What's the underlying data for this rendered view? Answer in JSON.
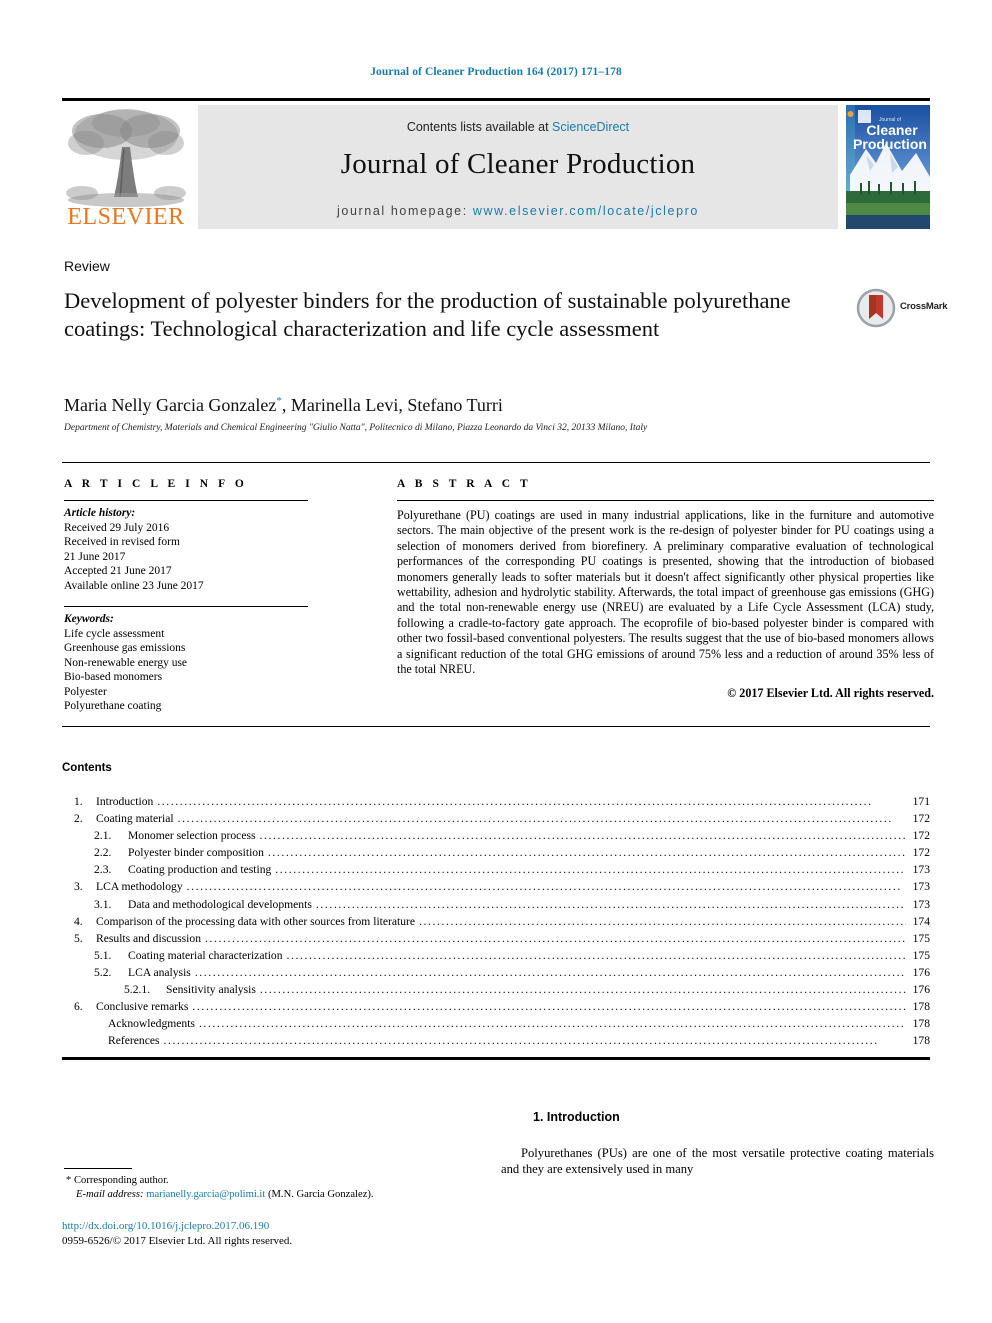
{
  "running_head": "Journal of Cleaner Production 164 (2017) 171–178",
  "masthead": {
    "contents_prefix": "Contents lists available at ",
    "sciencedirect": "ScienceDirect",
    "journal_title": "Journal of Cleaner Production",
    "homepage_prefix": "journal homepage: ",
    "homepage_url": "www.elsevier.com/locate/jclepro",
    "publisher": "ELSEVIER",
    "cover_line1": "Journal of",
    "cover_line2": "Cleaner",
    "cover_line3": "Production"
  },
  "article": {
    "doctype": "Review",
    "title": "Development of polyester binders for the production of sustainable polyurethane coatings: Technological characterization and life cycle assessment",
    "authors": "Maria Nelly Garcia Gonzalez",
    "authors_rest": ", Marinella Levi, Stefano Turri",
    "corresponding_marker": "*",
    "affiliation": "Department of Chemistry, Materials and Chemical Engineering \"Giulio Natta\", Politecnico di Milano, Piazza Leonardo da Vinci 32, 20133 Milano, Italy",
    "crossmark_label": "CrossMark"
  },
  "article_info": {
    "heading": "A R T I C L E  I N F O",
    "history_label": "Article history:",
    "history": [
      "Received 29 July 2016",
      "Received in revised form",
      "21 June 2017",
      "Accepted 21 June 2017",
      "Available online 23 June 2017"
    ],
    "keywords_label": "Keywords:",
    "keywords": [
      "Life cycle assessment",
      "Greenhouse gas emissions",
      "Non-renewable energy use",
      "Bio-based monomers",
      "Polyester",
      "Polyurethane coating"
    ]
  },
  "abstract": {
    "heading": "A B S T R A C T",
    "text": "Polyurethane (PU) coatings are used in many industrial applications, like in the furniture and automotive sectors. The main objective of the present work is the re-design of polyester binder for PU coatings using a selection of monomers derived from biorefinery. A preliminary comparative evaluation of technological performances of the corresponding PU coatings is presented, showing that the introduction of biobased monomers generally leads to softer materials but it doesn't affect significantly other physical properties like wettability, adhesion and hydrolytic stability. Afterwards, the total impact of greenhouse gas emissions (GHG) and the total non-renewable energy use (NREU) are evaluated by a Life Cycle Assessment (LCA) study, following a cradle-to-factory gate approach. The ecoprofile of bio-based polyester binder is compared with other two fossil-based conventional polyesters. The results suggest that the use of bio-based monomers allows a significant reduction of the total GHG emissions of around 75% less and a reduction of around 35% less of the total NREU.",
    "copyright": "© 2017 Elsevier Ltd. All rights reserved."
  },
  "contents": {
    "heading": "Contents",
    "entries": [
      {
        "level": 1,
        "num": "1.",
        "label": "Introduction",
        "page": "171"
      },
      {
        "level": 1,
        "num": "2.",
        "label": "Coating material",
        "page": "172"
      },
      {
        "level": 2,
        "num": "2.1.",
        "label": "Monomer selection process",
        "page": "172"
      },
      {
        "level": 2,
        "num": "2.2.",
        "label": "Polyester binder composition",
        "page": "172"
      },
      {
        "level": 2,
        "num": "2.3.",
        "label": "Coating production and testing",
        "page": "173"
      },
      {
        "level": 1,
        "num": "3.",
        "label": "LCA methodology",
        "page": "173"
      },
      {
        "level": 2,
        "num": "3.1.",
        "label": "Data and methodological developments",
        "page": "173"
      },
      {
        "level": 1,
        "num": "4.",
        "label": "Comparison of the processing data with other sources from literature",
        "page": "174"
      },
      {
        "level": 1,
        "num": "5.",
        "label": "Results and discussion",
        "page": "175"
      },
      {
        "level": 2,
        "num": "5.1.",
        "label": "Coating material characterization",
        "page": "175"
      },
      {
        "level": 2,
        "num": "5.2.",
        "label": "LCA analysis",
        "page": "176"
      },
      {
        "level": 3,
        "num": "5.2.1.",
        "label": "Sensitivity analysis",
        "page": "176"
      },
      {
        "level": 1,
        "num": "6.",
        "label": "Conclusive remarks",
        "page": "178"
      },
      {
        "level": 0,
        "num": "",
        "label": "Acknowledgments",
        "page": "178"
      },
      {
        "level": 0,
        "num": "",
        "label": "References",
        "page": "178"
      }
    ]
  },
  "footnotes": {
    "corresponding_marker": "*",
    "corresponding_text": "Corresponding author.",
    "email_label": "E-mail address:",
    "email": "marianelly.garcia@polimi.it",
    "email_owner": "(M.N. Garcia Gonzalez).",
    "doi": "http://dx.doi.org/10.1016/j.jclepro.2017.06.190",
    "issn": "0959-6526/© 2017 Elsevier Ltd. All rights reserved."
  },
  "intro": {
    "heading": "1.  Introduction",
    "paragraph": "Polyurethanes (PUs) are one of the most versatile protective coating materials and they are extensively used in many"
  }
}
